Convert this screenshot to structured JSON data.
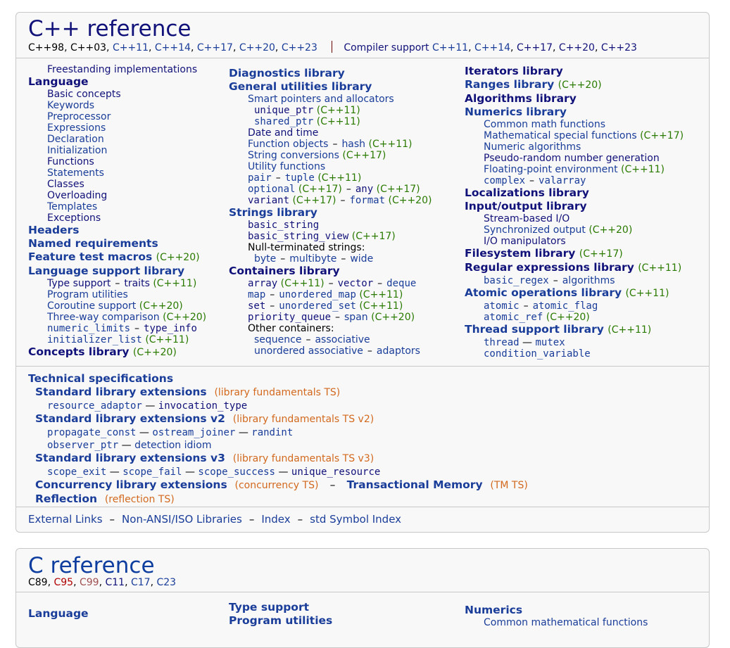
{
  "cpp": {
    "title": "C++ reference",
    "standards": [
      "C++98",
      "C++03",
      "C++11",
      "C++14",
      "C++17",
      "C++20",
      "C++23"
    ],
    "compiler_support_label": "Compiler support",
    "compiler_standards": [
      "C++11",
      "C++14",
      "C++17",
      "C++20",
      "C++23"
    ],
    "col1": {
      "freestanding": "Freestanding implementations",
      "language": "Language",
      "language_items": [
        "Basic concepts",
        "Keywords",
        "Preprocessor",
        "Expressions",
        "Declaration",
        "Initialization",
        "Functions",
        "Statements",
        "Classes",
        "Overloading",
        "Templates",
        "Exceptions"
      ],
      "headers": "Headers",
      "named_requirements": "Named requirements",
      "feature_test": "Feature test macros",
      "feature_test_ver": "(C++20)",
      "lang_support": "Language support library",
      "type_support": "Type support",
      "traits": "traits",
      "traits_ver": "(C++11)",
      "program_utilities": "Program utilities",
      "coroutine": "Coroutine support",
      "coroutine_ver": "(C++20)",
      "three_way": "Three-way comparison",
      "three_way_ver": "(C++20)",
      "numeric_limits": "numeric_limits",
      "type_info": "type_info",
      "initializer_list": "initializer_list",
      "initializer_list_ver": "(C++11)",
      "concepts": "Concepts library",
      "concepts_ver": "(C++20)"
    },
    "col2": {
      "diagnostics": "Diagnostics library",
      "general_utilities": "General utilities library",
      "smart_pointers": "Smart pointers and allocators",
      "unique_ptr": "unique_ptr",
      "unique_ptr_ver": "(C++11)",
      "shared_ptr": "shared_ptr",
      "shared_ptr_ver": "(C++11)",
      "date_time": "Date and time",
      "function_objects": "Function objects",
      "hash": "hash",
      "hash_ver": "(C++11)",
      "string_conversions": "String conversions",
      "string_conversions_ver": "(C++17)",
      "utility_functions": "Utility functions",
      "pair": "pair",
      "tuple": "tuple",
      "tuple_ver": "(C++11)",
      "optional": "optional",
      "optional_ver": "(C++17)",
      "any": "any",
      "any_ver": "(C++17)",
      "variant": "variant",
      "variant_ver": "(C++17)",
      "format": "format",
      "format_ver": "(C++20)",
      "strings": "Strings library",
      "basic_string": "basic_string",
      "basic_string_view": "basic_string_view",
      "basic_string_view_ver": "(C++17)",
      "null_terminated": "Null-terminated strings:",
      "byte": "byte",
      "multibyte": "multibyte",
      "wide": "wide",
      "containers": "Containers library",
      "array": "array",
      "array_ver": "(C++11)",
      "vector": "vector",
      "deque": "deque",
      "map": "map",
      "unordered_map": "unordered_map",
      "unordered_map_ver": "(C++11)",
      "set": "set",
      "unordered_set": "unordered_set",
      "unordered_set_ver": "(C++11)",
      "priority_queue": "priority_queue",
      "span": "span",
      "span_ver": "(C++20)",
      "other_containers": "Other containers:",
      "sequence": "sequence",
      "associative": "associative",
      "unordered_associative": "unordered associative",
      "adaptors": "adaptors"
    },
    "col3": {
      "iterators": "Iterators library",
      "ranges": "Ranges library",
      "ranges_ver": "(C++20)",
      "algorithms": "Algorithms library",
      "numerics": "Numerics library",
      "common_math": "Common math functions",
      "math_special": "Mathematical special functions",
      "math_special_ver": "(C++17)",
      "numeric_algorithms": "Numeric algorithms",
      "prng": "Pseudo-random number generation",
      "floating_env": "Floating-point environment",
      "floating_env_ver": "(C++11)",
      "complex": "complex",
      "valarray": "valarray",
      "localizations": "Localizations library",
      "io": "Input/output library",
      "stream_io": "Stream-based I/O",
      "sync_output": "Synchronized output",
      "sync_output_ver": "(C++20)",
      "io_manip": "I/O manipulators",
      "filesystem": "Filesystem library",
      "filesystem_ver": "(C++17)",
      "regex": "Regular expressions library",
      "regex_ver": "(C++11)",
      "basic_regex": "basic_regex",
      "regex_algorithms": "algorithms",
      "atomic_ops": "Atomic operations library",
      "atomic_ops_ver": "(C++11)",
      "atomic": "atomic",
      "atomic_flag": "atomic_flag",
      "atomic_ref": "atomic_ref",
      "atomic_ref_ver": "(C++20)",
      "thread": "Thread support library",
      "thread_ver": "(C++11)",
      "thread_item": "thread",
      "mutex": "mutex",
      "condition_variable": "condition_variable"
    },
    "ts": {
      "title": "Technical specifications",
      "ext1": "Standard library extensions",
      "ext1_note": "(library fundamentals TS)",
      "resource_adaptor": "resource_adaptor",
      "invocation_type": "invocation_type",
      "ext2": "Standard library extensions v2",
      "ext2_note": "(library fundamentals TS v2)",
      "propagate_const": "propagate_const",
      "ostream_joiner": "ostream_joiner",
      "randint": "randint",
      "observer_ptr": "observer_ptr",
      "detection_idiom": "detection idiom",
      "ext3": "Standard library extensions v3",
      "ext3_note": "(library fundamentals TS v3)",
      "scope_exit": "scope_exit",
      "scope_fail": "scope_fail",
      "scope_success": "scope_success",
      "unique_resource": "unique_resource",
      "concurrency": "Concurrency library extensions",
      "concurrency_note": "(concurrency TS)",
      "tm": "Transactional Memory",
      "tm_note": "(TM TS)",
      "reflection": "Reflection",
      "reflection_note": "(reflection TS)"
    },
    "footer": [
      "External Links",
      "Non-ANSI/ISO Libraries",
      "Index",
      "std Symbol Index"
    ]
  },
  "c": {
    "title": "C reference",
    "standards": [
      "C89",
      "C95",
      "C99",
      "C11",
      "C17",
      "C23"
    ],
    "col1_heading": "Language",
    "col2_headings": [
      "Type support",
      "Program utilities"
    ],
    "col3_heading": "Numerics",
    "col3_first_item": "Common mathematical functions"
  },
  "punct": {
    "comma": ", ",
    "dash": "–",
    "emdash": "—"
  }
}
